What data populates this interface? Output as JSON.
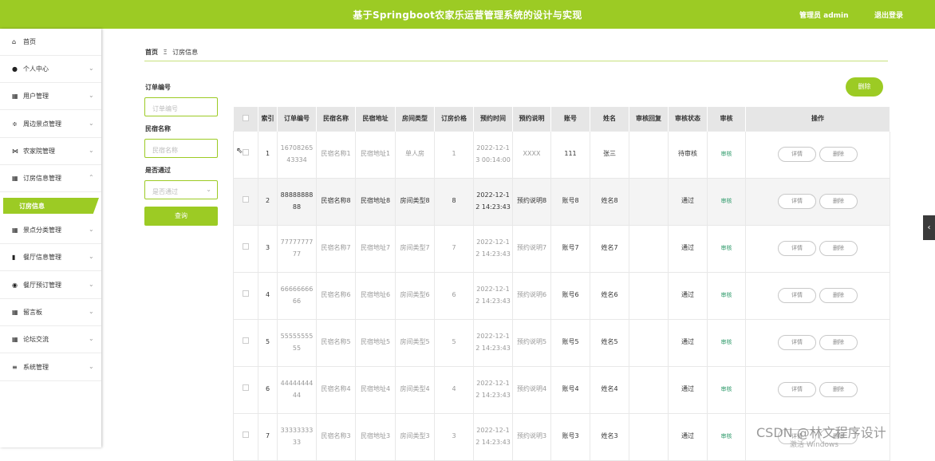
{
  "header": {
    "title": "基于Springboot农家乐运营管理系统的设计与实现",
    "admin_label": "管理员 admin",
    "logout_label": "退出登录",
    "brand_color": "#9ccb24"
  },
  "sidebar": {
    "items": [
      {
        "icon": "home-icon",
        "label": "首页",
        "chevron": false
      },
      {
        "icon": "user-icon",
        "label": "个人中心",
        "chevron": true
      },
      {
        "icon": "grid-icon",
        "label": "用户管理",
        "chevron": true
      },
      {
        "icon": "sliders-icon",
        "label": "周边景点管理",
        "chevron": true
      },
      {
        "icon": "bow-icon",
        "label": "农家院管理",
        "chevron": true
      },
      {
        "icon": "grid-icon",
        "label": "订房信息管理",
        "chevron": true,
        "expanded": true
      },
      {
        "icon": "grid-icon",
        "label": "景点分类管理",
        "chevron": true
      },
      {
        "icon": "bar-chart-icon",
        "label": "餐厅信息管理",
        "chevron": true
      },
      {
        "icon": "pin-icon",
        "label": "餐厅预订管理",
        "chevron": true
      },
      {
        "icon": "grid-icon",
        "label": "留言板",
        "chevron": true
      },
      {
        "icon": "grid-icon",
        "label": "论坛交流",
        "chevron": true
      },
      {
        "icon": "menu-icon",
        "label": "系统管理",
        "chevron": true
      }
    ],
    "active_sub_item": "订房信息"
  },
  "breadcrumb": {
    "home": "首页",
    "separator": "Ξ",
    "current": "订房信息"
  },
  "filters": {
    "order_no_label": "订单编号",
    "order_no_placeholder": "订单编号",
    "homestay_label": "民宿名称",
    "homestay_placeholder": "民宿名称",
    "passed_label": "是否通过",
    "passed_placeholder": "是否通过",
    "query_label": "查询"
  },
  "delete_label": "删除",
  "table": {
    "columns": [
      "",
      "索引",
      "订单编号",
      "民宿名称",
      "民宿地址",
      "房间类型",
      "订房价格",
      "预约时间",
      "预约说明",
      "账号",
      "姓名",
      "审核回复",
      "审核状态",
      "审核",
      "操作"
    ],
    "audit_action": "审核",
    "detail_label": "详情",
    "delete_label": "删除",
    "rows": [
      {
        "index": "1",
        "order_no": "1670826543334",
        "name": "民宿名称1",
        "address": "民宿地址1",
        "room_type": "单人房",
        "price": "1",
        "time": "2022-12-13 00:14:00",
        "note": "XXXX",
        "account": "111",
        "person": "张三",
        "reply": "",
        "status": "待审核",
        "highlight": false
      },
      {
        "index": "2",
        "order_no": "8888888888",
        "name": "民宿名称8",
        "address": "民宿地址8",
        "room_type": "房间类型8",
        "price": "8",
        "time": "2022-12-12 14:23:43",
        "note": "预约说明8",
        "account": "账号8",
        "person": "姓名8",
        "reply": "",
        "status": "通过",
        "highlight": true
      },
      {
        "index": "3",
        "order_no": "7777777777",
        "name": "民宿名称7",
        "address": "民宿地址7",
        "room_type": "房间类型7",
        "price": "7",
        "time": "2022-12-12 14:23:43",
        "note": "预约说明7",
        "account": "账号7",
        "person": "姓名7",
        "reply": "",
        "status": "通过",
        "highlight": false
      },
      {
        "index": "4",
        "order_no": "6666666666",
        "name": "民宿名称6",
        "address": "民宿地址6",
        "room_type": "房间类型6",
        "price": "6",
        "time": "2022-12-12 14:23:43",
        "note": "预约说明6",
        "account": "账号6",
        "person": "姓名6",
        "reply": "",
        "status": "通过",
        "highlight": false
      },
      {
        "index": "5",
        "order_no": "5555555555",
        "name": "民宿名称5",
        "address": "民宿地址5",
        "room_type": "房间类型5",
        "price": "5",
        "time": "2022-12-12 14:23:43",
        "note": "预约说明5",
        "account": "账号5",
        "person": "姓名5",
        "reply": "",
        "status": "通过",
        "highlight": false
      },
      {
        "index": "6",
        "order_no": "4444444444",
        "name": "民宿名称4",
        "address": "民宿地址4",
        "room_type": "房间类型4",
        "price": "4",
        "time": "2022-12-12 14:23:43",
        "note": "预约说明4",
        "account": "账号4",
        "person": "姓名4",
        "reply": "",
        "status": "通过",
        "highlight": false
      },
      {
        "index": "7",
        "order_no": "3333333333",
        "name": "民宿名称3",
        "address": "民宿地址3",
        "room_type": "房间类型3",
        "price": "3",
        "time": "2022-12-12 14:23:43",
        "note": "预约说明3",
        "account": "账号3",
        "person": "姓名3",
        "reply": "",
        "status": "通过",
        "highlight": false
      }
    ]
  },
  "watermark": "CSDN @林文程序设计",
  "activate_text": "激活 Windows"
}
